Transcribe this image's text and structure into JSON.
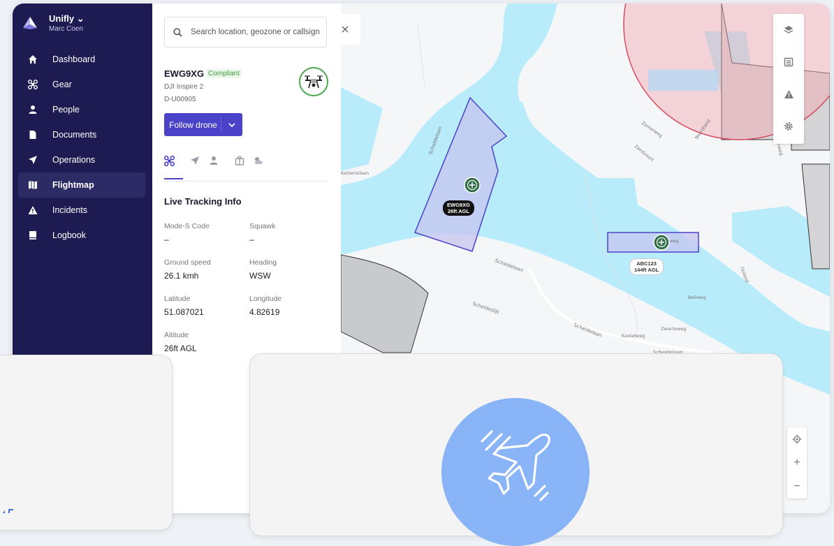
{
  "brand": {
    "org": "Unifly ⌄",
    "user": "Marc Coen"
  },
  "nav": [
    {
      "label": "Dashboard",
      "icon": "home-icon"
    },
    {
      "label": "Gear",
      "icon": "drone-icon"
    },
    {
      "label": "People",
      "icon": "person-icon"
    },
    {
      "label": "Documents",
      "icon": "document-icon"
    },
    {
      "label": "Operations",
      "icon": "send-icon"
    },
    {
      "label": "Flightmap",
      "icon": "map-icon",
      "active": true
    },
    {
      "label": "Incidents",
      "icon": "warning-icon"
    },
    {
      "label": "Logbook",
      "icon": "book-icon"
    }
  ],
  "search": {
    "placeholder": "Search location, geozone or callsign"
  },
  "drone": {
    "callsign": "EWG9XG",
    "status": "Compliant",
    "model": "DJI Inspire 2",
    "registration": "D-U00905",
    "follow_label": "Follow drone"
  },
  "tabs": [
    "drone-icon",
    "send-icon",
    "person-icon",
    "case-icon",
    "weather-icon"
  ],
  "tracking": {
    "title": "Live Tracking Info",
    "fields": [
      {
        "label": "Mode-S Code",
        "value": "–"
      },
      {
        "label": "Squawk",
        "value": "–"
      },
      {
        "label": "Ground speed",
        "value": "26.1 kmh"
      },
      {
        "label": "Heading",
        "value": "WSW"
      },
      {
        "label": "Latitude",
        "value": "51.087021"
      },
      {
        "label": "Longitude",
        "value": "4.82619"
      },
      {
        "label": "Altitude",
        "value": "26ft AGL"
      }
    ]
  },
  "map": {
    "markers": [
      {
        "callsign": "EWG9XG",
        "altitude": "26ft AGL"
      },
      {
        "callsign": "ABC123",
        "altitude": "144ft AGL"
      }
    ],
    "streets": [
      "Scheldelaan",
      "Scheldelaan",
      "Scheldedijk",
      "Scheldelaan",
      "Kastelweg",
      "Scheldelaan",
      "Zwarteweg",
      "Beliweg",
      "Ouland",
      "Zandvoort",
      "Zomerweg",
      "Noordland",
      "Havenweg",
      "Kettenislaan",
      "Eglaweg"
    ],
    "controls": [
      "layers-icon",
      "list-icon",
      "warning-icon",
      "gear-icon"
    ],
    "zoom": [
      "locate-icon",
      "+",
      "−"
    ]
  },
  "colors": {
    "sidebar": "#1d1b52",
    "accent": "#4a43c9",
    "water": "#b9ecfb",
    "zone_fill": "#c5c4ef",
    "restricted": "#f3a8b2",
    "plane_circle": "#8ab4f8",
    "compliant": "#3e9b3e"
  }
}
